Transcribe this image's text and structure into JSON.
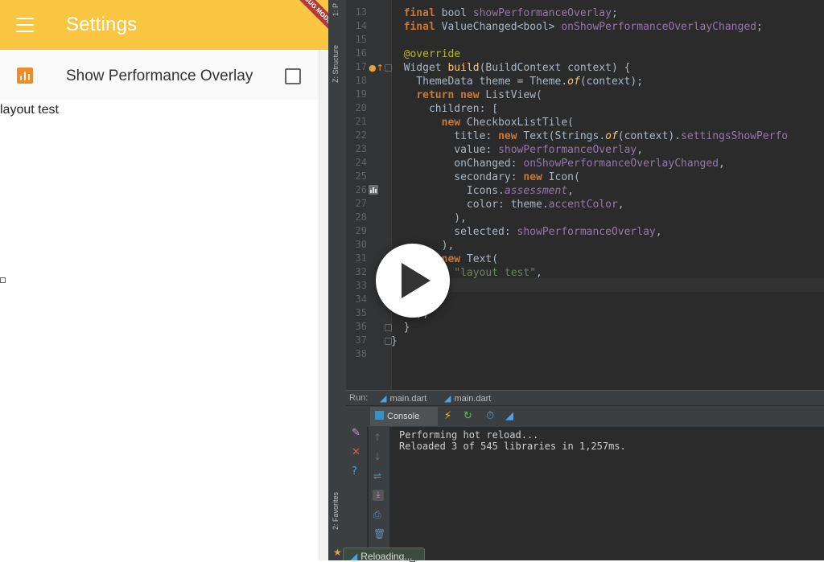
{
  "phone": {
    "app_title": "Settings",
    "debug_banner": "DEBUG MODE",
    "tile": {
      "title": "Show Performance Overlay",
      "checked": false,
      "icon": "assessment-icon",
      "icon_color": "#f08a2b"
    },
    "body_text": "layout test",
    "appbar_color": "#f9c642"
  },
  "ide": {
    "side_tabs": [
      "1: P",
      "Z: Structure",
      "2: Favorites"
    ],
    "code_lines": [
      {
        "n": "13",
        "t": "  final bool showPerformanceOverlay;"
      },
      {
        "n": "14",
        "t": "  final ValueChanged<bool> onShowPerformanceOverlayChanged;"
      },
      {
        "n": "15",
        "t": ""
      },
      {
        "n": "16",
        "t": "  @override"
      },
      {
        "n": "17",
        "t": "  Widget build(BuildContext context) {"
      },
      {
        "n": "18",
        "t": "    ThemeData theme = Theme.of(context);"
      },
      {
        "n": "19",
        "t": "    return new ListView("
      },
      {
        "n": "20",
        "t": "      children: ["
      },
      {
        "n": "21",
        "t": "        new CheckboxListTile("
      },
      {
        "n": "22",
        "t": "          title: new Text(Strings.of(context).settingsShowPerfo"
      },
      {
        "n": "23",
        "t": "          value: showPerformanceOverlay,"
      },
      {
        "n": "24",
        "t": "          onChanged: onShowPerformanceOverlayChanged,"
      },
      {
        "n": "25",
        "t": "          secondary: new Icon("
      },
      {
        "n": "26",
        "t": "            Icons.assessment,"
      },
      {
        "n": "27",
        "t": "            color: theme.accentColor,"
      },
      {
        "n": "28",
        "t": "          ),"
      },
      {
        "n": "29",
        "t": "          selected: showPerformanceOverlay,"
      },
      {
        "n": "30",
        "t": "        ),"
      },
      {
        "n": "31",
        "t": "        new Text("
      },
      {
        "n": "32",
        "t": "          \"layout test\","
      },
      {
        "n": "33",
        "t": "        )"
      },
      {
        "n": "34",
        "t": "      ],"
      },
      {
        "n": "35",
        "t": "    );"
      },
      {
        "n": "36",
        "t": "  }"
      },
      {
        "n": "37",
        "t": "}"
      },
      {
        "n": "38",
        "t": ""
      }
    ],
    "run_panel": {
      "label": "Run:",
      "tabs": [
        "main.dart",
        "main.dart"
      ],
      "console_tab": "Console",
      "output": [
        "Performing hot reload...",
        "Reloaded 3 of 545 libraries in 1,257ms."
      ],
      "toast": "Reloading..."
    },
    "colors": {
      "background": "#2b2b2b",
      "keyword": "#cc7832",
      "field": "#9876aa",
      "string": "#6a8759",
      "annotation": "#bbb529"
    }
  },
  "overlay": {
    "icon": "play-icon"
  }
}
